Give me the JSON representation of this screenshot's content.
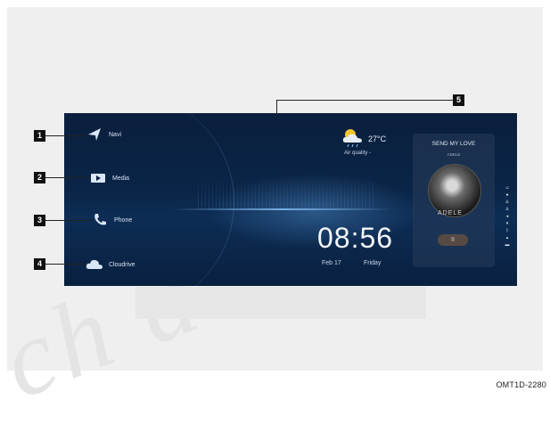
{
  "callouts": [
    "1",
    "2",
    "3",
    "4",
    "5"
  ],
  "menu": {
    "navi": "Navi",
    "media": "Media",
    "phone": "Phone",
    "cloudrive": "Cloudrive"
  },
  "weather": {
    "icon": "partly-cloudy-rain-icon",
    "temperature": "27°C",
    "air_quality": "Air  quality -"
  },
  "clock": {
    "time": "08:56",
    "date": "Feb 17",
    "day": "Friday"
  },
  "music": {
    "song": "SEND MY LOVE",
    "artist": "ADELE",
    "album_label": "ADELE",
    "pause": "II"
  },
  "document_code": "OMT1D-2280",
  "colors": {
    "screen": "#0b1f3d",
    "accent": "#8cc8ff",
    "callout": "#111111"
  }
}
